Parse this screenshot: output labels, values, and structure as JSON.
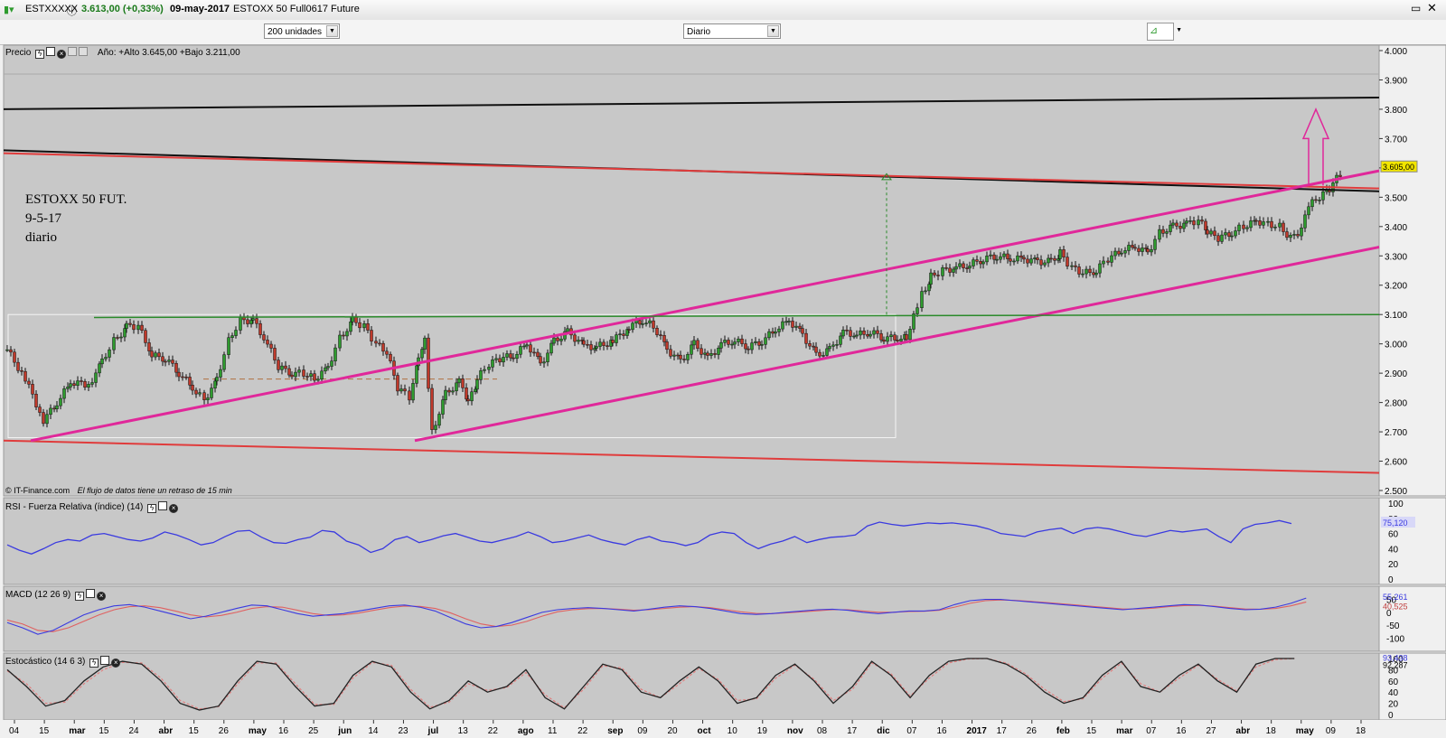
{
  "window": {
    "symbol": "ESTXXXXX",
    "last_price": "3.613,00 (+0,33%)",
    "date": "09-may-2017",
    "instrument": "ESTOXX 50 Full0617 Future"
  },
  "toolbar": {
    "units_select": "200 unidades",
    "period_select": "Diario"
  },
  "colors": {
    "background": "#c8c8c8",
    "candle_up": "#2e9b2e",
    "candle_down": "#c0392b",
    "trend_magenta": "#e0289a",
    "trend_red": "#e03c3c",
    "trend_black": "#111111",
    "support_green": "#2a8a2a",
    "rsi_line": "#3a3ae0",
    "macd_line": "#3a3ae0",
    "signal_line": "#e06060"
  },
  "price_panel": {
    "title": "Precio",
    "info": "Año: +Alto 3.645,00 +Bajo 3.211,00",
    "annotation_lines": [
      "ESTOXX 50 FUT.",
      "9-5-17",
      "diario"
    ],
    "footer_credit": "© IT-Finance.com",
    "footer_note": "El flujo de datos tiene un retraso de 15 min",
    "current_label": "3.605,00"
  },
  "rsi_panel": {
    "title": "RSI - Fuerza Relativa (índice) (14)",
    "current_label": "75,120"
  },
  "macd_panel": {
    "title": "MACD (12 26 9)",
    "label_macd": "55,261",
    "label_signal": "40,525"
  },
  "stoch_panel": {
    "title": "Estocástico (14 6 3)",
    "label_k": "93,438",
    "label_d": "92,287"
  },
  "x_axis": {
    "ticks": [
      "04",
      "15",
      "mar",
      "15",
      "24",
      "abr",
      "15",
      "26",
      "may",
      "16",
      "25",
      "jun",
      "14",
      "23",
      "jul",
      "13",
      "22",
      "ago",
      "11",
      "22",
      "sep",
      "09",
      "20",
      "oct",
      "10",
      "19",
      "nov",
      "08",
      "17",
      "dic",
      "07",
      "16",
      "2017",
      "17",
      "26",
      "feb",
      "15",
      "mar",
      "07",
      "16",
      "27",
      "abr",
      "18",
      "may",
      "09",
      "18"
    ],
    "bold": [
      "mar",
      "abr",
      "may",
      "jun",
      "jul",
      "ago",
      "sep",
      "oct",
      "nov",
      "dic",
      "2017",
      "feb",
      "mar",
      "abr",
      "may"
    ]
  },
  "chart_data": [
    {
      "type": "candlestick",
      "title": "Precio",
      "ylim": [
        2500,
        4000
      ],
      "y_ticks": [
        "4.000",
        "3.900",
        "3.800",
        "3.700",
        "3.600",
        "3.500",
        "3.400",
        "3.300",
        "3.200",
        "3.100",
        "3.000",
        "2.900",
        "2.800",
        "2.700",
        "2.600",
        "2.500"
      ],
      "close_series": [
        [
          0,
          2980
        ],
        [
          20,
          2880
        ],
        [
          40,
          2740
        ],
        [
          55,
          2800
        ],
        [
          70,
          2870
        ],
        [
          90,
          2860
        ],
        [
          105,
          2940
        ],
        [
          118,
          3010
        ],
        [
          132,
          3060
        ],
        [
          145,
          3060
        ],
        [
          160,
          2960
        ],
        [
          175,
          2950
        ],
        [
          190,
          2900
        ],
        [
          205,
          2850
        ],
        [
          218,
          2810
        ],
        [
          232,
          2880
        ],
        [
          245,
          3010
        ],
        [
          258,
          3080
        ],
        [
          272,
          3080
        ],
        [
          288,
          3000
        ],
        [
          300,
          2920
        ],
        [
          315,
          2900
        ],
        [
          328,
          2900
        ],
        [
          340,
          2880
        ],
        [
          355,
          2920
        ],
        [
          368,
          3020
        ],
        [
          382,
          3080
        ],
        [
          395,
          3060
        ],
        [
          408,
          3000
        ],
        [
          420,
          2970
        ],
        [
          432,
          2850
        ],
        [
          445,
          2820
        ],
        [
          455,
          2960
        ],
        [
          462,
          3020
        ],
        [
          470,
          2700
        ],
        [
          485,
          2830
        ],
        [
          500,
          2870
        ],
        [
          510,
          2800
        ],
        [
          520,
          2880
        ],
        [
          533,
          2930
        ],
        [
          545,
          2950
        ],
        [
          560,
          2960
        ],
        [
          575,
          3000
        ],
        [
          590,
          2930
        ],
        [
          605,
          3010
        ],
        [
          620,
          3040
        ],
        [
          638,
          2990
        ],
        [
          652,
          2990
        ],
        [
          670,
          3010
        ],
        [
          688,
          3060
        ],
        [
          703,
          3080
        ],
        [
          715,
          3060
        ],
        [
          730,
          2980
        ],
        [
          745,
          2940
        ],
        [
          760,
          3000
        ],
        [
          775,
          2950
        ],
        [
          790,
          3000
        ],
        [
          805,
          3010
        ],
        [
          820,
          2990
        ],
        [
          835,
          3010
        ],
        [
          850,
          3050
        ],
        [
          865,
          3080
        ],
        [
          880,
          3030
        ],
        [
          895,
          2960
        ],
        [
          910,
          2980
        ],
        [
          925,
          3040
        ],
        [
          940,
          3030
        ],
        [
          955,
          3040
        ],
        [
          970,
          3020
        ],
        [
          985,
          3020
        ],
        [
          995,
          3020
        ],
        [
          1003,
          3100
        ],
        [
          1012,
          3170
        ],
        [
          1022,
          3230
        ],
        [
          1035,
          3250
        ],
        [
          1050,
          3260
        ],
        [
          1065,
          3270
        ],
        [
          1080,
          3290
        ],
        [
          1095,
          3300
        ],
        [
          1110,
          3290
        ],
        [
          1125,
          3290
        ],
        [
          1140,
          3280
        ],
        [
          1155,
          3280
        ],
        [
          1165,
          3310
        ],
        [
          1178,
          3260
        ],
        [
          1190,
          3240
        ],
        [
          1205,
          3250
        ],
        [
          1218,
          3290
        ],
        [
          1233,
          3320
        ],
        [
          1248,
          3330
        ],
        [
          1262,
          3310
        ],
        [
          1275,
          3380
        ],
        [
          1290,
          3400
        ],
        [
          1305,
          3410
        ],
        [
          1318,
          3420
        ],
        [
          1328,
          3380
        ],
        [
          1340,
          3360
        ],
        [
          1355,
          3380
        ],
        [
          1368,
          3400
        ],
        [
          1382,
          3420
        ],
        [
          1395,
          3410
        ],
        [
          1408,
          3400
        ],
        [
          1420,
          3360
        ],
        [
          1432,
          3390
        ],
        [
          1440,
          3470
        ],
        [
          1452,
          3500
        ],
        [
          1463,
          3530
        ],
        [
          1475,
          3580
        ],
        [
          1486,
          3605
        ]
      ],
      "trendlines": [
        {
          "color": "black",
          "from": [
            0,
            3660
          ],
          "to": [
            1540,
            3520
          ]
        },
        {
          "color": "black",
          "from": [
            0,
            3800
          ],
          "to": [
            1540,
            3840
          ]
        },
        {
          "color": "red",
          "from": [
            0,
            3650
          ],
          "to": [
            1540,
            3530
          ]
        },
        {
          "color": "red",
          "from": [
            0,
            2670
          ],
          "to": [
            1540,
            2560
          ]
        },
        {
          "color": "magenta",
          "from": [
            30,
            2670
          ],
          "to": [
            1600,
            3590
          ]
        },
        {
          "color": "magenta",
          "from": [
            455,
            2670
          ],
          "to": [
            1600,
            3330
          ]
        },
        {
          "color": "green",
          "from": [
            100,
            3090
          ],
          "to": [
            1600,
            3100
          ]
        }
      ]
    },
    {
      "type": "line",
      "title": "RSI - Fuerza Relativa (índice) (14)",
      "ylim": [
        0,
        100
      ],
      "y_ticks": [
        "100",
        "80",
        "60",
        "40",
        "20",
        "0"
      ],
      "series": [
        {
          "values": [
            45,
            38,
            33,
            40,
            48,
            52,
            50,
            58,
            60,
            56,
            52,
            50,
            54,
            62,
            58,
            52,
            45,
            48,
            56,
            63,
            64,
            55,
            48,
            47,
            52,
            55,
            64,
            62,
            50,
            45,
            35,
            40,
            52,
            56,
            48,
            52,
            57,
            60,
            55,
            50,
            48,
            52,
            56,
            62,
            56,
            48,
            50,
            54,
            58,
            52,
            48,
            45,
            52,
            56,
            50,
            48,
            44,
            48,
            58,
            62,
            60,
            48,
            40,
            46,
            50,
            56,
            48,
            52,
            55,
            56,
            58,
            70,
            75,
            72,
            70,
            72,
            74,
            73,
            74,
            72,
            70,
            66,
            60,
            58,
            56,
            62,
            65,
            67,
            60,
            66,
            68,
            66,
            62,
            58,
            56,
            60,
            64,
            62,
            64,
            66,
            56,
            48,
            66,
            72,
            74,
            77,
            73
          ]
        }
      ]
    },
    {
      "type": "line",
      "title": "MACD (12 26 9)",
      "ylim": [
        -130,
        80
      ],
      "y_ticks": [
        "50",
        "0",
        "-50",
        "-100"
      ],
      "series": [
        {
          "name": "MACD",
          "values": [
            -40,
            -60,
            -85,
            -70,
            -40,
            -10,
            10,
            25,
            30,
            20,
            5,
            -10,
            -25,
            -15,
            0,
            15,
            28,
            25,
            10,
            -5,
            -15,
            -10,
            -5,
            5,
            15,
            25,
            28,
            20,
            5,
            -20,
            -45,
            -60,
            -55,
            -40,
            -20,
            0,
            10,
            15,
            18,
            15,
            10,
            5,
            12,
            20,
            25,
            22,
            15,
            5,
            -5,
            -8,
            -5,
            0,
            5,
            10,
            12,
            8,
            0,
            -5,
            0,
            5,
            5,
            10,
            30,
            45,
            50,
            50,
            45,
            40,
            35,
            30,
            25,
            20,
            15,
            10,
            15,
            20,
            25,
            30,
            28,
            22,
            15,
            10,
            12,
            20,
            35,
            55
          ]
        },
        {
          "name": "Signal",
          "values": [
            -30,
            -45,
            -70,
            -75,
            -60,
            -35,
            -10,
            10,
            22,
            25,
            18,
            5,
            -10,
            -18,
            -12,
            0,
            15,
            22,
            20,
            8,
            -5,
            -12,
            -10,
            -3,
            8,
            18,
            24,
            23,
            15,
            -2,
            -25,
            -45,
            -55,
            -50,
            -35,
            -15,
            2,
            10,
            14,
            15,
            12,
            8,
            10,
            15,
            20,
            22,
            18,
            10,
            2,
            -4,
            -5,
            -2,
            2,
            6,
            10,
            10,
            5,
            0,
            0,
            3,
            4,
            8,
            20,
            35,
            45,
            48,
            46,
            42,
            38,
            33,
            28,
            23,
            18,
            13,
            13,
            16,
            22,
            26,
            27,
            24,
            18,
            13,
            12,
            15,
            25,
            40
          ]
        }
      ]
    },
    {
      "type": "line",
      "title": "Estocástico (14 6 3)",
      "ylim": [
        0,
        100
      ],
      "y_ticks": [
        "100",
        "80",
        "60",
        "40",
        "20",
        "0"
      ],
      "series": [
        {
          "name": "%K",
          "values": [
            80,
            50,
            15,
            25,
            60,
            85,
            95,
            90,
            60,
            20,
            8,
            15,
            60,
            95,
            90,
            50,
            15,
            20,
            70,
            95,
            85,
            40,
            10,
            25,
            60,
            40,
            50,
            80,
            30,
            10,
            50,
            90,
            80,
            40,
            30,
            60,
            85,
            60,
            20,
            30,
            70,
            90,
            60,
            20,
            50,
            95,
            70,
            30,
            70,
            95,
            100,
            100,
            90,
            70,
            40,
            20,
            30,
            70,
            95,
            50,
            40,
            70,
            90,
            60,
            40,
            90,
            100,
            100
          ]
        },
        {
          "name": "%D",
          "values": [
            78,
            55,
            20,
            22,
            55,
            80,
            93,
            92,
            65,
            25,
            10,
            14,
            55,
            92,
            92,
            55,
            18,
            18,
            65,
            93,
            88,
            45,
            13,
            22,
            55,
            43,
            48,
            75,
            35,
            12,
            45,
            87,
            83,
            45,
            30,
            55,
            82,
            63,
            25,
            28,
            65,
            88,
            63,
            25,
            45,
            92,
            73,
            33,
            65,
            92,
            99,
            100,
            92,
            73,
            45,
            23,
            28,
            65,
            92,
            55,
            40,
            65,
            88,
            63,
            42,
            85,
            98,
            100
          ]
        }
      ]
    }
  ]
}
